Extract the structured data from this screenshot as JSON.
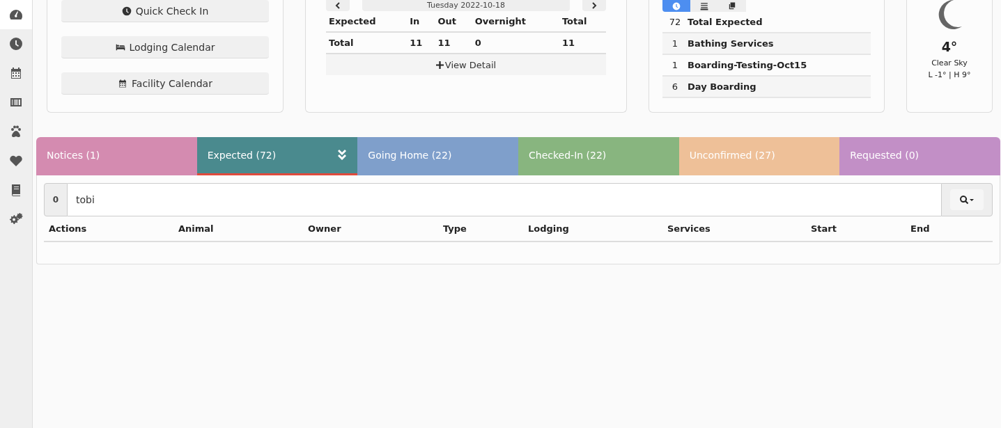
{
  "sidebar": {
    "items": [
      {
        "kind": "gauge",
        "selected": true
      },
      {
        "kind": "clock",
        "selected": false
      },
      {
        "kind": "calendar",
        "selected": false
      },
      {
        "kind": "barcode",
        "selected": false
      },
      {
        "kind": "paw",
        "selected": false
      },
      {
        "kind": "heart",
        "selected": false
      },
      {
        "kind": "book",
        "selected": false
      },
      {
        "kind": "gears",
        "selected": false
      }
    ]
  },
  "quick_actions": [
    {
      "kind": "clock",
      "label": "Quick Check In"
    },
    {
      "kind": "bed",
      "label": "Lodging Calendar"
    },
    {
      "kind": "calendar",
      "label": "Facility Calendar"
    }
  ],
  "summary": {
    "date": "Tuesday 2022-10-18",
    "columns": [
      "Expected",
      "In",
      "Out",
      "Overnight",
      "Total"
    ],
    "rows": [
      [
        "Total",
        "11",
        "11",
        "0",
        "11"
      ]
    ],
    "view_detail": "View Detail"
  },
  "services": {
    "views": [
      {
        "kind": "clock",
        "selected": true
      },
      {
        "kind": "list",
        "selected": false
      },
      {
        "kind": "copy",
        "selected": false
      }
    ],
    "rows": [
      {
        "count": "72",
        "name": "Total Expected"
      },
      {
        "count": "1",
        "name": "Bathing Services"
      },
      {
        "count": "1",
        "name": "Boarding-Testing-Oct15"
      },
      {
        "count": "6",
        "name": "Day Boarding"
      }
    ]
  },
  "weather": {
    "temperature": "4°",
    "condition": "Clear Sky",
    "range": "L -1° | H 9°"
  },
  "tabs": [
    {
      "label": "Notices (1)",
      "color": "#d48bb0",
      "selected": false
    },
    {
      "label": "Expected (72)",
      "color": "#4a8a8e",
      "selected": true
    },
    {
      "label": "Going Home (22)",
      "color": "#7f9fcb",
      "selected": false
    },
    {
      "label": "Checked-In (22)",
      "color": "#88b57f",
      "selected": false
    },
    {
      "label": "Unconfirmed (27)",
      "color": "#eec098",
      "selected": false
    },
    {
      "label": "Requested (0)",
      "color": "#c28fc6",
      "selected": false
    }
  ],
  "search": {
    "count": "0",
    "value": "tobi"
  },
  "table": {
    "columns": [
      "Actions",
      "Animal",
      "Owner",
      "Type",
      "Lodging",
      "Services",
      "Start",
      "End"
    ]
  }
}
